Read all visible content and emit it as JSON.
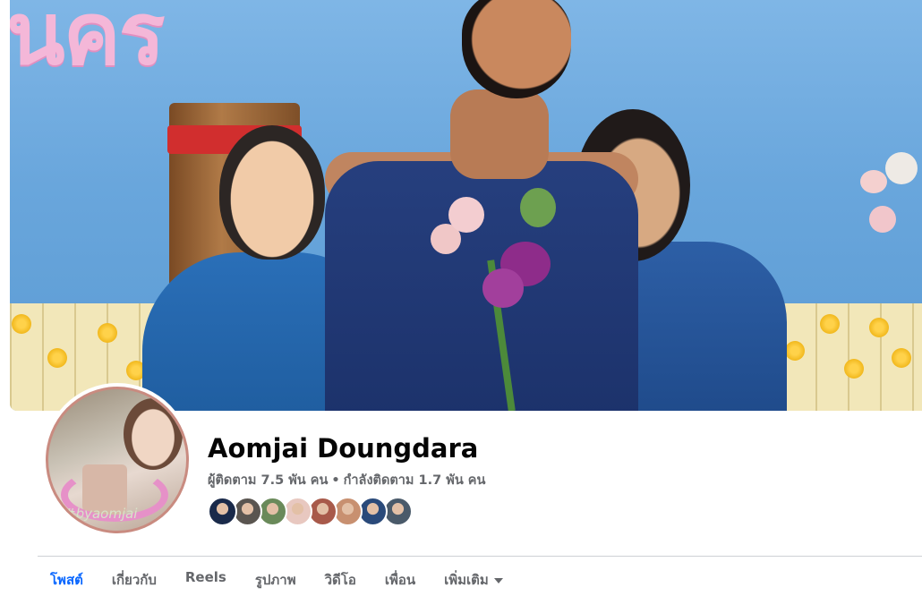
{
  "profile": {
    "name": "Aomjai Doungdara",
    "followers": "ผู้ติดตาม 7.5 พัน คน",
    "separator": "•",
    "following": "กำลังติดตาม 1.7 พัน คน",
    "profile_watermark": "#byaomjai"
  },
  "cover": {
    "backdrop_text": "นคร"
  },
  "friends": {
    "avatar_colors": [
      "#1a2a4a",
      "#5a5550",
      "#6a8a5a",
      "#e8c8c0",
      "#a85a4a",
      "#c89070",
      "#2a4a7a",
      "#4a5a6a"
    ]
  },
  "tabs": [
    {
      "label": "โพสต์",
      "active": true
    },
    {
      "label": "เกี่ยวกับ",
      "active": false
    },
    {
      "label": "Reels",
      "active": false
    },
    {
      "label": "รูปภาพ",
      "active": false
    },
    {
      "label": "วิดีโอ",
      "active": false
    },
    {
      "label": "เพื่อน",
      "active": false
    },
    {
      "label": "เพิ่มเติม",
      "active": false
    }
  ],
  "colors": {
    "accent": "#0866ff",
    "text_primary": "#050505",
    "text_secondary": "#65676b"
  }
}
